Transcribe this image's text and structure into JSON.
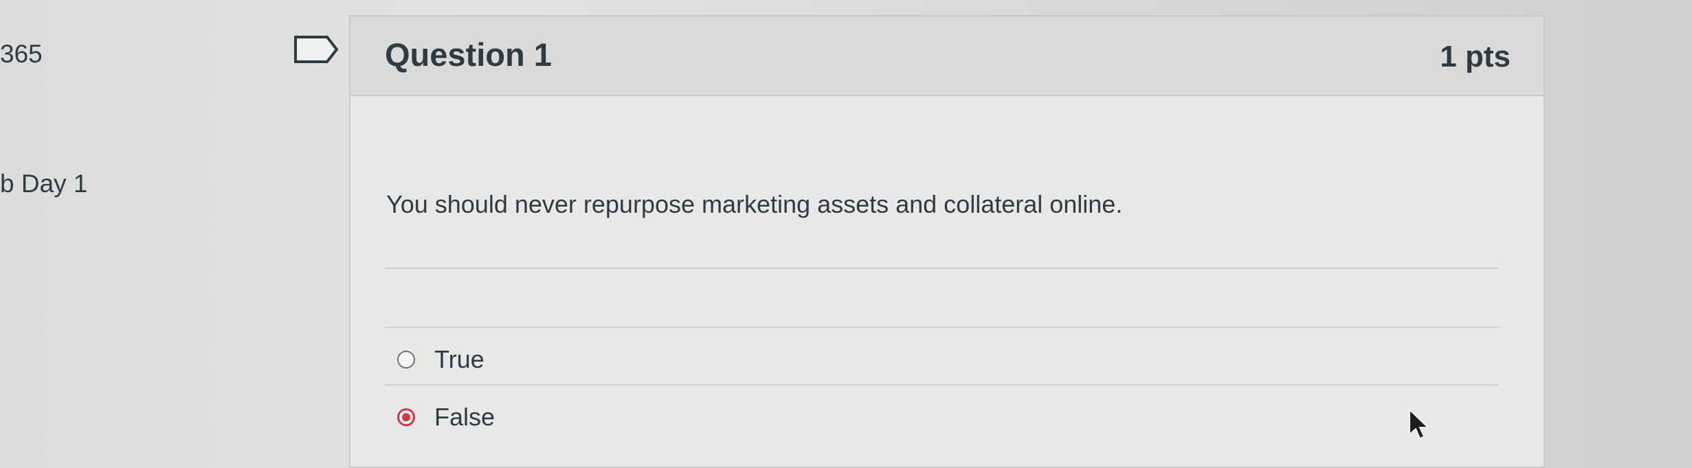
{
  "sidebar": {
    "course_code": "365",
    "module_name": "b Day 1"
  },
  "question": {
    "title": "Question 1",
    "points": "1 pts",
    "text": "You should never repurpose marketing assets and collateral online.",
    "flag_icon": "flag-outline-icon",
    "answers": [
      {
        "label": "True",
        "selected": false
      },
      {
        "label": "False",
        "selected": true
      }
    ]
  },
  "colors": {
    "accent": "#d63347",
    "text": "#2d3b45",
    "header_bg": "#dadad8"
  }
}
